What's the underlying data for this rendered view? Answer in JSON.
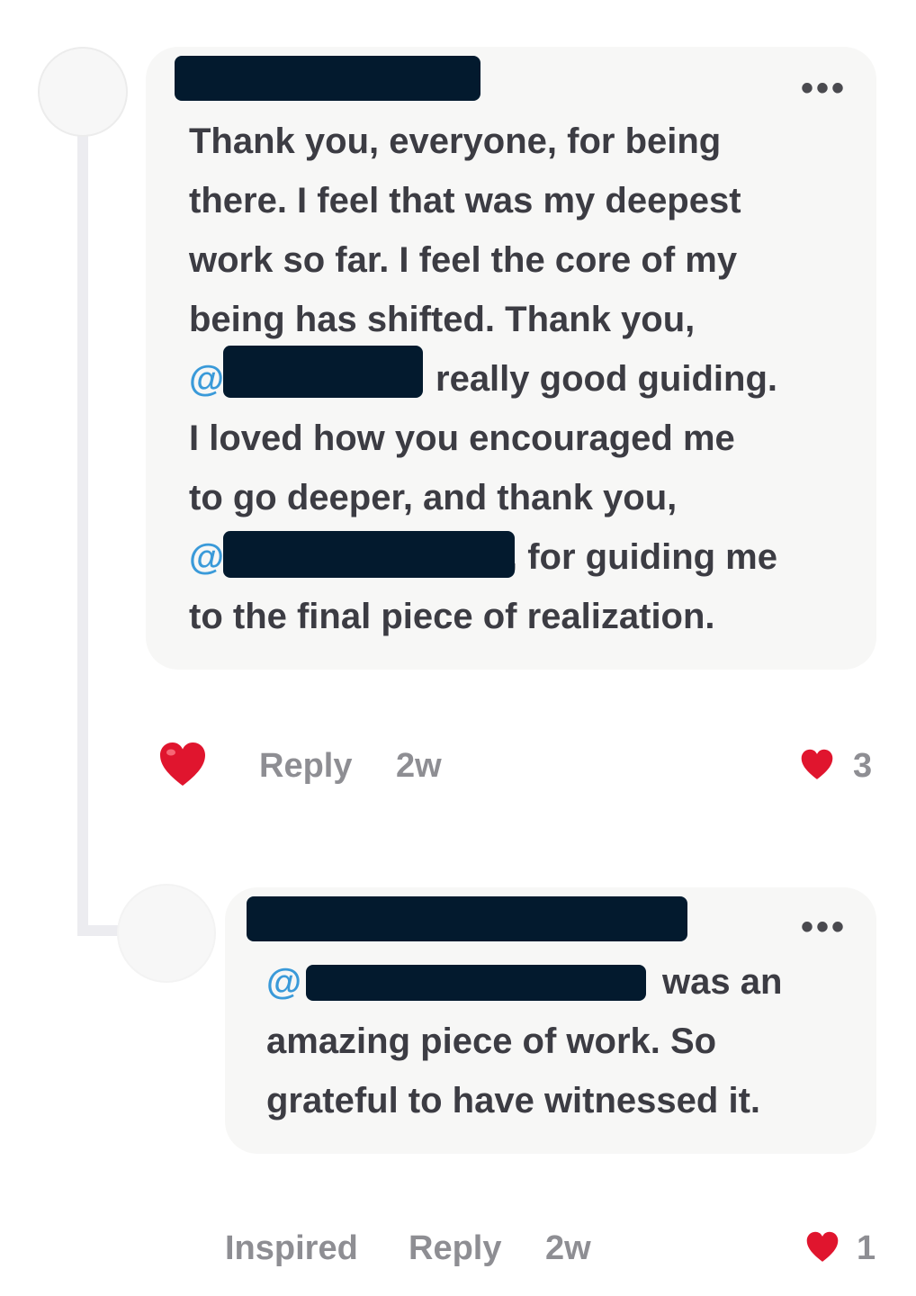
{
  "comments": [
    {
      "more_label": "•••",
      "lines": [
        "Thank you, everyone, for being",
        "there. I feel that was my deepest",
        "work so far. I feel the core of my",
        "being has shifted. Thank you,"
      ],
      "mention_1_prefix": "@",
      "after_mention_1": "really good guiding.",
      "lines_2": [
        "I loved how you encouraged me",
        "to go deeper, and thank you,"
      ],
      "mention_2_prefix": "@",
      "after_mention_2": ", for guiding me",
      "last_line": "to the final piece of realization.",
      "reply_label": "Reply",
      "time": "2w",
      "like_count": "3"
    },
    {
      "more_label": "•••",
      "mention_prefix": "@",
      "after_mention": "was an",
      "lines": [
        "amazing piece of work. So",
        "grateful to have witnessed it."
      ],
      "reaction_label": "Inspired",
      "reply_label": "Reply",
      "time": "2w",
      "like_count": "1"
    }
  ],
  "colors": {
    "mention": "#3a9ad9",
    "redaction": "#031a2e",
    "heart": "#e0152e"
  }
}
